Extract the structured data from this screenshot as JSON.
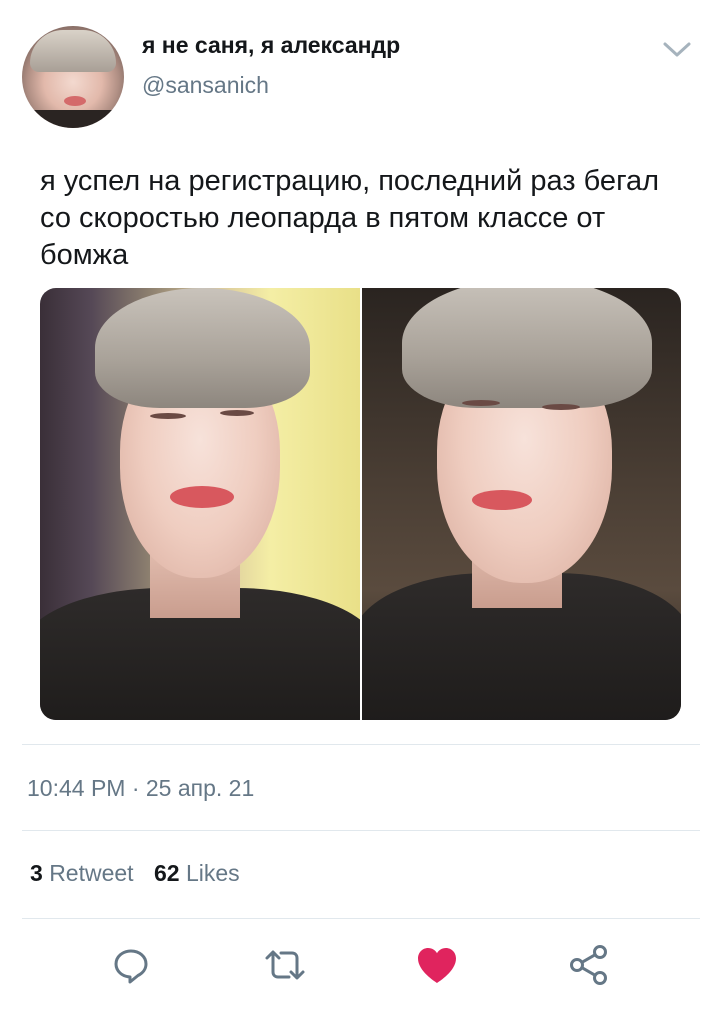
{
  "user": {
    "display_name": "я не саня, я александр",
    "handle": "@sansanich"
  },
  "tweet": {
    "text": "я успел на регистрацию, последний раз бегал со скоростью леопарда в пятом классе от бомжа",
    "timestamp": "10:44 PM · 25 апр. 21"
  },
  "stats": {
    "retweets_count": "3",
    "retweets_label": "Retweet",
    "likes_count": "62",
    "likes_label": "Likes"
  },
  "actions": {
    "reply_icon": "reply-icon",
    "retweet_icon": "retweet-icon",
    "like_icon": "heart-icon",
    "share_icon": "share-icon"
  },
  "colors": {
    "text_primary": "#14171a",
    "text_secondary": "#657786",
    "like_active": "#e0245e",
    "divider": "#e1e8ed"
  }
}
